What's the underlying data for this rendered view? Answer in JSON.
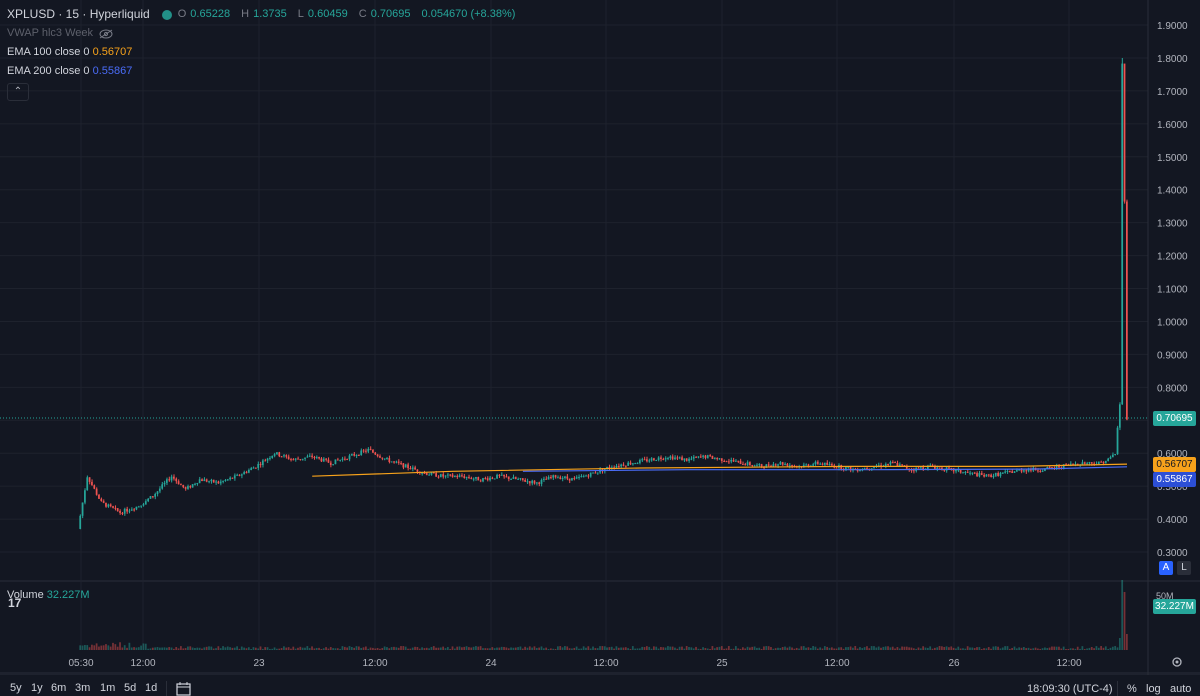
{
  "legend": {
    "symbol": "XPLUSD · 15 · Hyperliquid",
    "o_label": "O",
    "o": "0.65228",
    "h_label": "H",
    "h": "1.3735",
    "l_label": "L",
    "l": "0.60459",
    "c_label": "C",
    "c": "0.70695",
    "change": "0.054670 (+8.38%)",
    "vwap": "VWAP hlc3 Week",
    "ema100_name": "EMA 100 close 0",
    "ema100_value": "0.56707",
    "ema200_name": "EMA 200 close 0",
    "ema200_value": "0.55867"
  },
  "price_tags": {
    "last": "0.70695",
    "ema100": "0.56707",
    "ema200": "0.55867",
    "volume": "32.227M"
  },
  "volume_legend": {
    "label": "Volume",
    "value": "32.227M",
    "axis_label": "50M"
  },
  "timeframes": [
    "5y",
    "1y",
    "6m",
    "3m",
    "1m",
    "5d",
    "1d"
  ],
  "footer": {
    "time": "18:09:30 (UTC-4)",
    "percent": "%",
    "log": "log",
    "auto": "auto"
  },
  "scale_buttons": {
    "a": "A",
    "l": "L"
  },
  "colors": {
    "up": "#26a69a",
    "down": "#ef5350",
    "ema100": "#f7a21b",
    "ema200": "#4a6cf7",
    "bg": "#131722"
  },
  "chart_data": {
    "type": "candlestick",
    "y_ticks": [
      "1.9000",
      "1.8000",
      "1.7000",
      "1.6000",
      "1.5000",
      "1.4000",
      "1.3000",
      "1.2000",
      "1.1000",
      "1.0000",
      "0.9000",
      "0.8000",
      "0.7000",
      "0.6000",
      "0.5000",
      "0.4000",
      "0.3000"
    ],
    "x_ticks": [
      "05:30",
      "12:00",
      "23",
      "12:00",
      "24",
      "12:00",
      "25",
      "12:00",
      "26",
      "12:00"
    ],
    "ylim": [
      0.27,
      1.935
    ],
    "series": [
      {
        "name": "EMA 100 close 0",
        "last": 0.56707
      },
      {
        "name": "EMA 200 close 0",
        "last": 0.55867
      }
    ],
    "path": [
      [
        0,
        0.37
      ],
      [
        4,
        0.53
      ],
      [
        10,
        0.45
      ],
      [
        18,
        0.42
      ],
      [
        26,
        0.44
      ],
      [
        32,
        0.47
      ],
      [
        40,
        0.53
      ],
      [
        46,
        0.49
      ],
      [
        52,
        0.52
      ],
      [
        60,
        0.51
      ],
      [
        68,
        0.53
      ],
      [
        76,
        0.56
      ],
      [
        84,
        0.6
      ],
      [
        92,
        0.58
      ],
      [
        100,
        0.59
      ],
      [
        108,
        0.57
      ],
      [
        116,
        0.59
      ],
      [
        124,
        0.61
      ],
      [
        132,
        0.58
      ],
      [
        140,
        0.56
      ],
      [
        148,
        0.54
      ],
      [
        156,
        0.53
      ],
      [
        164,
        0.53
      ],
      [
        172,
        0.52
      ],
      [
        180,
        0.53
      ],
      [
        188,
        0.52
      ],
      [
        196,
        0.51
      ],
      [
        204,
        0.53
      ],
      [
        212,
        0.52
      ],
      [
        220,
        0.54
      ],
      [
        228,
        0.56
      ],
      [
        236,
        0.57
      ],
      [
        244,
        0.58
      ],
      [
        252,
        0.59
      ],
      [
        260,
        0.58
      ],
      [
        268,
        0.59
      ],
      [
        276,
        0.58
      ],
      [
        284,
        0.57
      ],
      [
        292,
        0.56
      ],
      [
        300,
        0.57
      ],
      [
        308,
        0.56
      ],
      [
        316,
        0.57
      ],
      [
        324,
        0.56
      ],
      [
        332,
        0.55
      ],
      [
        340,
        0.56
      ],
      [
        348,
        0.57
      ],
      [
        356,
        0.55
      ],
      [
        364,
        0.56
      ],
      [
        372,
        0.55
      ],
      [
        380,
        0.54
      ],
      [
        388,
        0.53
      ],
      [
        396,
        0.54
      ],
      [
        404,
        0.55
      ],
      [
        412,
        0.55
      ],
      [
        420,
        0.56
      ],
      [
        428,
        0.57
      ],
      [
        436,
        0.57
      ],
      [
        440,
        0.58
      ],
      [
        443,
        0.6
      ],
      [
        445,
        0.75
      ],
      [
        446,
        1.78
      ],
      [
        447,
        1.37
      ],
      [
        448,
        0.70695
      ]
    ],
    "ema100_path": [
      [
        100,
        0.53
      ],
      [
        160,
        0.545
      ],
      [
        240,
        0.555
      ],
      [
        330,
        0.56
      ],
      [
        400,
        0.56
      ],
      [
        448,
        0.567
      ]
    ],
    "ema200_path": [
      [
        190,
        0.545
      ],
      [
        260,
        0.55
      ],
      [
        340,
        0.55
      ],
      [
        410,
        0.552
      ],
      [
        448,
        0.5587
      ]
    ],
    "last_price": 0.70695
  }
}
